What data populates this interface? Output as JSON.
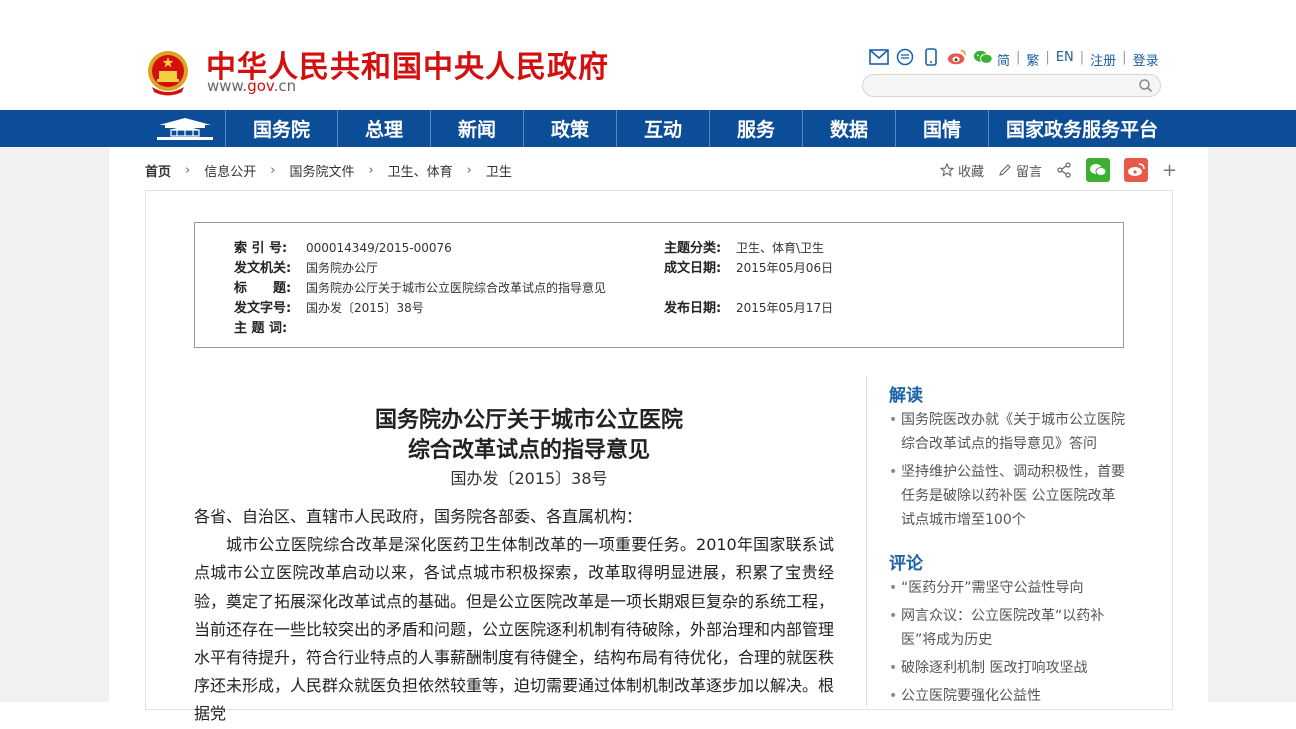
{
  "header": {
    "site_title": "中华人民共和国中央人民政府",
    "site_url_prefix": "www.",
    "site_url_domain": "gov",
    "site_url_suffix": ".cn",
    "top_links": [
      "简",
      "繁",
      "EN",
      "注册",
      "登录"
    ],
    "icons": [
      "mail-icon",
      "rss-icon",
      "mobile-icon",
      "weibo-icon",
      "wechat-icon"
    ],
    "search_placeholder": ""
  },
  "nav": {
    "items": [
      "国务院",
      "总理",
      "新闻",
      "政策",
      "互动",
      "服务",
      "数据",
      "国情",
      "国家政务服务平台"
    ]
  },
  "breadcrumb": [
    "首页",
    "信息公开",
    "国务院文件",
    "卫生、体育",
    "卫生"
  ],
  "tools": {
    "favorite": "收藏",
    "comment": "留言",
    "plus": "+"
  },
  "meta": {
    "index_label": "索 引 号:",
    "index_value": "000014349/2015-00076",
    "topic_label": "主题分类:",
    "topic_value": "卫生、体育\\卫生",
    "issuer_label": "发文机关:",
    "issuer_value": "国务院办公厅",
    "date_label": "成文日期:",
    "date_value": "2015年05月06日",
    "title_label": "标　　题:",
    "title_value": "国务院办公厅关于城市公立医院综合改革试点的指导意见",
    "doc_no_label": "发文字号:",
    "doc_no_value": "国办发〔2015〕38号",
    "publish_label": "发布日期:",
    "publish_value": "2015年05月17日",
    "keywords_label": "主 题 词:",
    "keywords_value": ""
  },
  "article": {
    "title_line1": "国务院办公厅关于城市公立医院",
    "title_line2": "综合改革试点的指导意见",
    "doc_number": "国办发〔2015〕38号",
    "greeting": "各省、自治区、直辖市人民政府，国务院各部委、各直属机构：",
    "paragraph1": "城市公立医院综合改革是深化医药卫生体制改革的一项重要任务。2010年国家联系试点城市公立医院改革启动以来，各试点城市积极探索，改革取得明显进展，积累了宝贵经验，奠定了拓展深化改革试点的基础。但是公立医院改革是一项长期艰巨复杂的系统工程，当前还存在一些比较突出的矛盾和问题，公立医院逐利机制有待破除，外部治理和内部管理水平有待提升，符合行业特点的人事薪酬制度有待健全，结构布局有待优化，合理的就医秩序还未形成，人民群众就医负担依然较重等，迫切需要通过体制机制改革逐步加以解决。根据党"
  },
  "sidebar": {
    "interpret_heading": "解读",
    "interpret_items": [
      "国务院医改办就《关于城市公立医院综合改革试点的指导意见》答问",
      "坚持维护公益性、调动积极性，首要任务是破除以药补医 公立医院改革试点城市增至100个"
    ],
    "comment_heading": "评论",
    "comment_items": [
      "“医药分开”需坚守公益性导向",
      "网言众议：公立医院改革“以药补医”将成为历史",
      "破除逐利机制 医改打响攻坚战",
      "公立医院要强化公益性"
    ]
  },
  "colors": {
    "nav_bg": "#0c4d97",
    "title_red": "#d40f0f",
    "link_blue": "#1b62a8",
    "wechat_green": "#3cb034",
    "weibo_orange": "#e8594a"
  }
}
